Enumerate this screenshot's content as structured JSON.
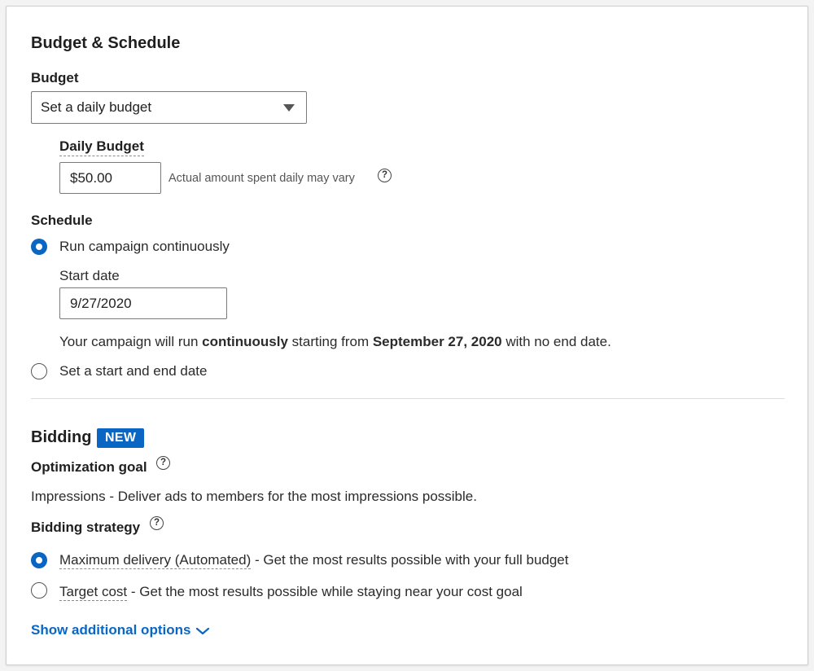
{
  "budget_schedule": {
    "title": "Budget & Schedule",
    "budget_label": "Budget",
    "budget_select_value": "Set a daily budget",
    "daily_budget_label": "Daily Budget",
    "daily_budget_value": "$50.00",
    "daily_budget_hint": "Actual amount spent daily may vary"
  },
  "schedule": {
    "label": "Schedule",
    "option_continuous": "Run campaign continuously",
    "start_date_label": "Start date",
    "start_date_value": "9/27/2020",
    "summary": {
      "part1": "Your campaign will run ",
      "bold1": "continuously",
      "part2": " starting from ",
      "bold2": "September 27, 2020",
      "part3": " with no end date."
    },
    "option_start_end": "Set a start and end date"
  },
  "bidding": {
    "title": "Bidding",
    "badge": "NEW",
    "optimization_goal_label": "Optimization goal",
    "optimization_goal_text": "Impressions - Deliver ads to members for the most impressions possible.",
    "strategy_label": "Bidding strategy",
    "option_max_delivery_name": "Maximum delivery (Automated)",
    "option_max_delivery_desc": " - Get the most results possible with your full budget",
    "option_target_cost_name": "Target cost",
    "option_target_cost_desc": " - Get the most results possible while staying near your cost goal",
    "show_more": "Show additional options"
  },
  "colors": {
    "accent": "#0a66c2",
    "border": "#7a7a7a",
    "divider": "#dcdcdc"
  },
  "icons": [
    "dropdown-caret-icon",
    "help-icon",
    "chevron-down-icon"
  ]
}
